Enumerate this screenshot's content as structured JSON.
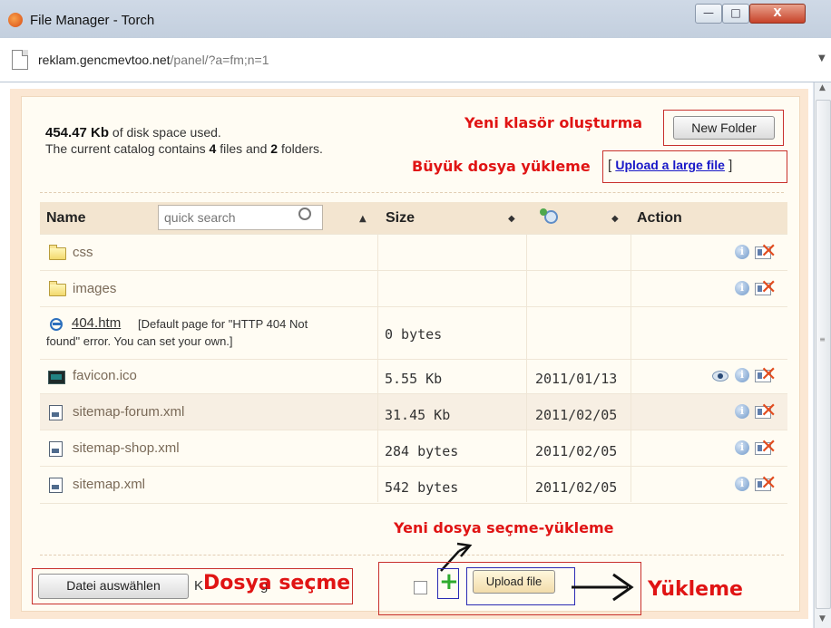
{
  "window": {
    "title": "File Manager - Torch",
    "buttons": {
      "minimize": "—",
      "maximize": "□",
      "close": "X"
    }
  },
  "address": {
    "host": "reklam.gencmevtoo.net",
    "path": "/panel/?a=fm;n=1"
  },
  "summary": {
    "disk_used_value": "454.47 Kb",
    "disk_used_suffix": " of disk space used.",
    "catalog_prefix": "The current catalog contains ",
    "files_count": "4",
    "files_word": " files and ",
    "folders_count": "2",
    "folders_word": " folders."
  },
  "toolbar": {
    "new_folder_label": "New Folder",
    "upload_large_open": "[ ",
    "upload_large_link": "Upload a large file",
    "upload_large_close": " ]"
  },
  "annotations": {
    "new_folder": "Yeni klasör oluşturma",
    "upload_large": "Büyük dosya yükleme",
    "select_upload": "Yeni dosya seçme-yükleme",
    "choose_file": "Dosya seçme",
    "upload": "Yükleme"
  },
  "table": {
    "headers": {
      "name": "Name",
      "size": "Size",
      "action": "Action"
    },
    "search_placeholder": "quick search",
    "sort_up": "▲",
    "sort_both": "◆",
    "rows": [
      {
        "name": "css",
        "type": "folder-icon",
        "size": "",
        "date": ""
      },
      {
        "name": "images",
        "type": "folder-icon",
        "size": "",
        "date": ""
      },
      {
        "name": "404.htm",
        "type": "ie-icon",
        "note": "[Default page for \"HTTP 404 Not",
        "note2": "found\" error. You can set your own.]",
        "size": "0 bytes",
        "date": ""
      },
      {
        "name": "favicon.ico",
        "type": "ico-icon",
        "size": "5.55 Kb",
        "date": "2011/01/13"
      },
      {
        "name": "sitemap-forum.xml",
        "type": "xml-icon",
        "size": "31.45 Kb",
        "date": "2011/02/05"
      },
      {
        "name": "sitemap-shop.xml",
        "type": "xml-icon",
        "size": "284 bytes",
        "date": "2011/02/05"
      },
      {
        "name": "sitemap.xml",
        "type": "xml-icon",
        "size": "542 bytes",
        "date": "2011/02/05"
      }
    ]
  },
  "footer": {
    "choose_file_label": "Datei auswählen",
    "no_file_text": "K",
    "no_file_tail": "g",
    "upload_file_label": "Upload file",
    "plus_symbol": "+"
  },
  "icons": {
    "info": "i",
    "delete": "✕",
    "arrow": "➜"
  },
  "colors": {
    "annotation_red": "#e01414",
    "panel_peach": "#fbe7d3",
    "link_blue": "#1818c8"
  }
}
